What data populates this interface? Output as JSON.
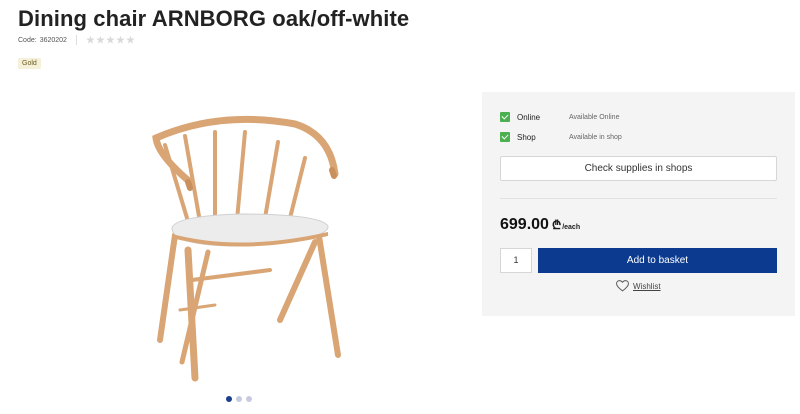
{
  "product": {
    "title": "Dining chair ARNBORG oak/off-white",
    "code_label": "Code:",
    "code": "3620202",
    "rating_stars": 0,
    "rating_max": 5,
    "badge": "Gold"
  },
  "gallery": {
    "image_icon": "chair-image",
    "dots": 3,
    "active_dot": 0
  },
  "availability": [
    {
      "label": "Online",
      "status": "Available Online",
      "checked": true
    },
    {
      "label": "Shop",
      "status": "Available in shop",
      "checked": true
    }
  ],
  "actions": {
    "check_shops": "Check supplies in shops",
    "price": "699.00",
    "currency_symbol": "₾",
    "unit": "/each",
    "quantity": "1",
    "add_to_basket": "Add to basket",
    "wishlist": "Wishlist"
  },
  "colors": {
    "accent": "#0b3a8f",
    "check": "#4caf50",
    "badge_bg": "#f5f0d8"
  }
}
